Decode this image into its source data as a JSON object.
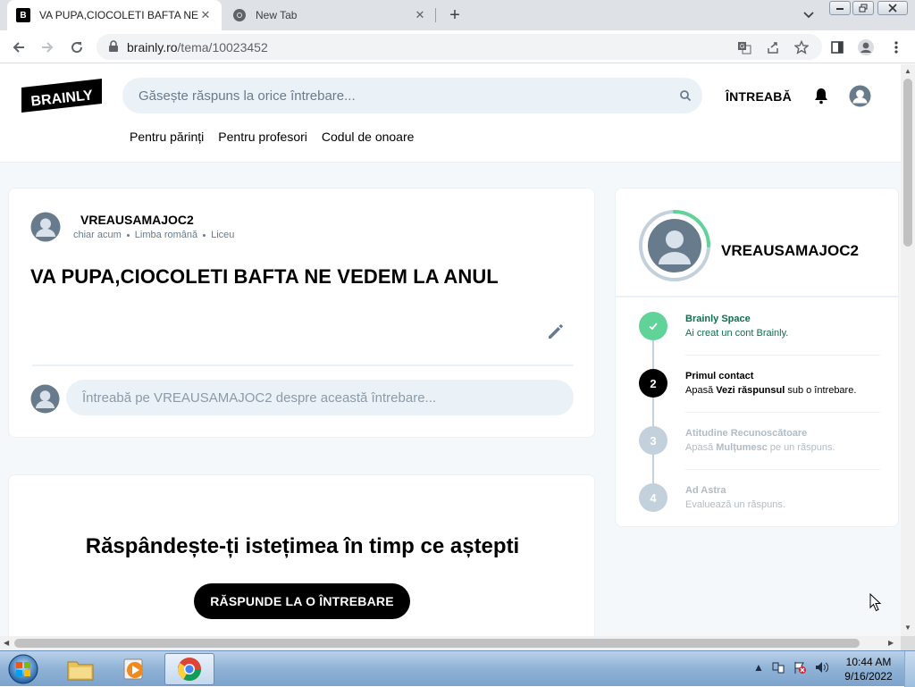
{
  "browser": {
    "tabs": [
      {
        "title": "VA PUPA,CIOCOLETI BAFTA NE V",
        "favicon": "brainly-b-icon",
        "active": true
      },
      {
        "title": "New Tab",
        "favicon": "chrome-icon",
        "active": false
      }
    ],
    "new_tab_symbol": "+",
    "close_symbol": "✕",
    "url_host": "brainly.ro",
    "url_path": "/tema/10023452"
  },
  "header": {
    "logo_text": "BRAINLY",
    "search_placeholder": "Găsește răspuns la orice întrebare...",
    "ask_label": "ÎNTREABĂ",
    "nav": [
      "Pentru părinți",
      "Pentru profesori",
      "Codul de onoare"
    ]
  },
  "question": {
    "username": "VREAUSAMAJOC2",
    "time": "chiar acum",
    "subject": "Limba română",
    "level": "Liceu",
    "text": "VA PUPA,CIOCOLETI BAFTA NE VEDEM LA ANUL",
    "comment_placeholder": "Întreabă pe VREAUSAMAJOC2 despre această întrebare..."
  },
  "promo": {
    "heading": "Răspândește-ți istețimea în timp ce aștepti",
    "button_label": "RĂSPUNDE LA O ÎNTREBARE"
  },
  "profile_panel": {
    "username": "VREAUSAMAJOC2",
    "progress_fraction": 0.25,
    "steps": [
      {
        "number": "✓",
        "title": "Brainly Space",
        "desc": "Ai creat un cont Brainly.",
        "state": "done"
      },
      {
        "number": "2",
        "title": "Primul contact",
        "desc_pre": "Apasă ",
        "desc_bold": "Vezi răspunsul",
        "desc_post": " sub o întrebare.",
        "state": "current"
      },
      {
        "number": "3",
        "title": "Atitudine Recunoscătoare",
        "desc_pre": "Apasă ",
        "desc_bold": "Mulțumesc",
        "desc_post": " pe un răspuns.",
        "state": "locked"
      },
      {
        "number": "4",
        "title": "Ad Astra",
        "desc": "Evaluează un răspuns.",
        "state": "locked"
      }
    ]
  },
  "taskbar": {
    "time": "10:44 AM",
    "date": "9/16/2022"
  },
  "colors": {
    "done_green": "#60d399",
    "done_title": "#0f6e4b",
    "locked_grey": "#c3d1dd",
    "locked_text": "#b0bcc6"
  }
}
